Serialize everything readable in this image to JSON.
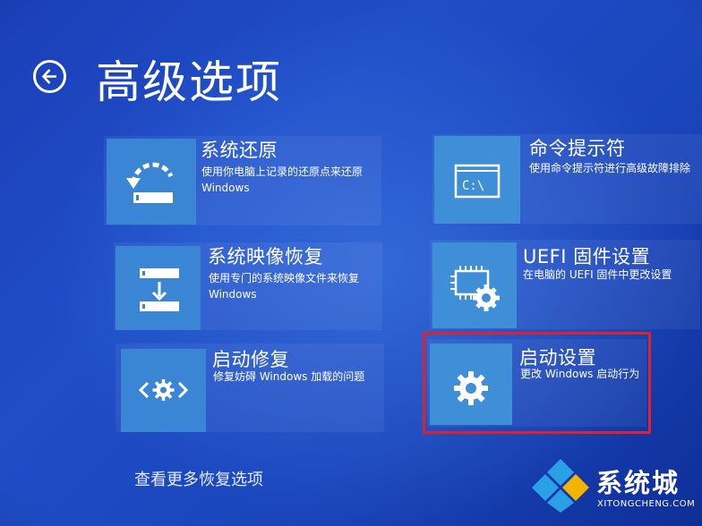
{
  "header": {
    "title": "高级选项",
    "back_icon": "arrow-left-icon"
  },
  "options": [
    {
      "id": "system-restore",
      "title": "系统还原",
      "desc1": "使用你电脑上记录的还原点来还原",
      "desc2": "Windows",
      "icon": "system-restore-icon"
    },
    {
      "id": "command-prompt",
      "title": "命令提示符",
      "desc1": "使用命令提示符进行高级故障排除",
      "desc2": "",
      "icon": "command-prompt-icon",
      "icon_text": "C:\\"
    },
    {
      "id": "system-image-recovery",
      "title": "系统映像恢复",
      "desc1": "使用专门的系统映像文件来恢复",
      "desc2": "Windows",
      "icon": "system-image-icon"
    },
    {
      "id": "uefi-firmware-settings",
      "title": "UEFI 固件设置",
      "desc1": "在电脑的 UEFI 固件中更改设置",
      "desc2": "",
      "icon": "uefi-chip-gear-icon"
    },
    {
      "id": "startup-repair",
      "title": "启动修复",
      "desc1": "修复妨碍 Windows 加载的问题",
      "desc2": "",
      "icon": "startup-repair-icon"
    },
    {
      "id": "startup-settings",
      "title": "启动设置",
      "desc1": "更改 Windows 启动行为",
      "desc2": "",
      "icon": "gear-icon"
    }
  ],
  "more_link": "查看更多恢复选项",
  "watermark": {
    "text": "系统城",
    "subtext": "XITONGCHENG.COM",
    "icon": "xitongcheng-logo-icon"
  },
  "colors": {
    "background": "#1f4ec8",
    "tile_icon": "#3d8ad6",
    "highlight": "#e0202a"
  }
}
